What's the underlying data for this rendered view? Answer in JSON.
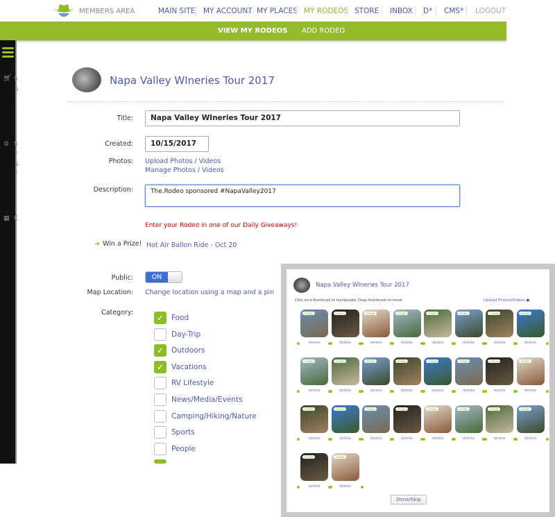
{
  "header": {
    "logo_text": "MEMBERS AREA",
    "nav": [
      {
        "label": "MAIN SITE"
      },
      {
        "label": "MY ACCOUNT"
      },
      {
        "label": "MY PLACES"
      },
      {
        "label": "MY RODEOS",
        "active": true
      },
      {
        "label": "STORE"
      },
      {
        "label": "INBOX"
      },
      {
        "label": "D*"
      },
      {
        "label": "CMS*"
      },
      {
        "label": "LOGOUT"
      }
    ],
    "subnav": [
      {
        "label": "VIEW MY RODEOS",
        "active": true
      },
      {
        "label": "ADD RODEO"
      }
    ]
  },
  "sidebar": {
    "items": [
      "S",
      "S",
      "I",
      "S",
      "F",
      "S",
      "F",
      "C"
    ]
  },
  "page": {
    "title": "Napa Valley WIneries Tour 2017"
  },
  "form": {
    "title_label": "Title:",
    "title_value": "Napa Valley WIneries Tour 2017",
    "created_label": "Created:",
    "created_value": "10/15/2017",
    "photos_label": "Photos:",
    "upload_link": "Upload Photos / Videos",
    "manage_link": "Manage Photos / Videos",
    "description_label": "Description:",
    "description_value": "The.Rodeo sponsored #NapaValley2017",
    "giveaway_text": "Enter your Rodeo in one of our Daily Giveaways!",
    "prize_label": "Win a Prize!",
    "prize_link": "Hot Air Ballon Ride - Oct 20",
    "public_label": "Public:",
    "public_state": "ON",
    "map_label": "Map Location:",
    "map_link": "Change location using a map and a pin",
    "category_label": "Category:",
    "categories": [
      {
        "label": "Food",
        "checked": true
      },
      {
        "label": "Day-Trip",
        "checked": false
      },
      {
        "label": "Outdoors",
        "checked": true
      },
      {
        "label": "Vacations",
        "checked": true
      },
      {
        "label": "RV Lifestyle",
        "checked": false
      },
      {
        "label": "News/Media/Events",
        "checked": false
      },
      {
        "label": "Camping/Hiking/Nature",
        "checked": false
      },
      {
        "label": "Sports",
        "checked": false
      },
      {
        "label": "People",
        "checked": false
      }
    ]
  },
  "overlay": {
    "title": "Napa Valley WIneries Tour 2017",
    "instructions": "Click on a thumbnail to manipulate. Drag thumbnails to move.",
    "upload_link": "Upload Photos/Videos",
    "done_label": "Done/Skip",
    "badge": "image",
    "delete_label": "delete",
    "photo_count": 26
  },
  "colors": {
    "accent": "#93bb2c",
    "link": "#4a5aa8",
    "alert": "#cc0000",
    "sidebar": "#111111"
  }
}
